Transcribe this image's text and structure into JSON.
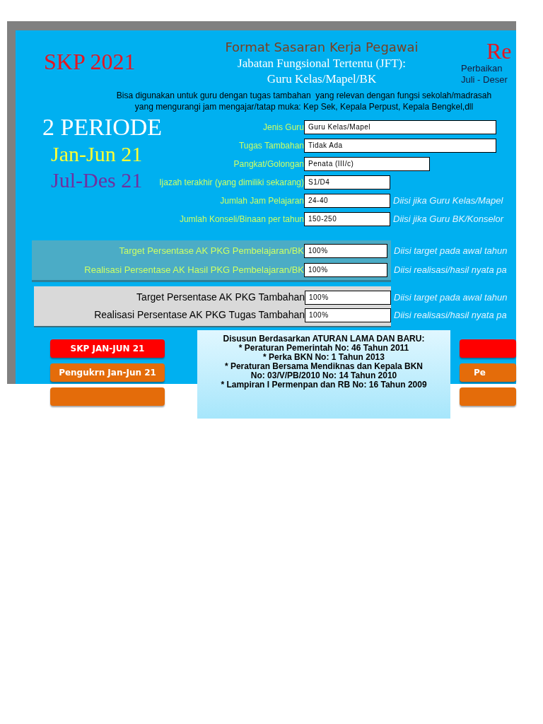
{
  "header": {
    "badge": "SKP 2021",
    "title": "Format Sasaran Kerja Pegawai",
    "subtitle_lines": [
      "Jabatan Fungsional Tertentu (JFT):",
      "Guru Kelas/Mapel/BK"
    ],
    "revision_title": "Re",
    "revision_lines": [
      "Perbaikan",
      "Juli - Deser"
    ]
  },
  "description_lines": [
    "Bisa digunakan untuk guru dengan tugas tambahan  yang relevan dengan fungsi sekolah/madrasah",
    "yang mengurangi jam mengajar/tatap muka: Kep Sek, Kepala Perpust, Kepala Bengkel,dll"
  ],
  "periods": {
    "heading": "2 PERIODE",
    "items": [
      {
        "label": "Jan-Jun 21",
        "color": "#ffff33"
      },
      {
        "label": "Jul-Des 21",
        "color": "#7030a0"
      }
    ]
  },
  "fields": [
    {
      "label": "Jenis Guru",
      "value": "Guru Kelas/Mapel"
    },
    {
      "label": "Tugas Tambahan",
      "value": "Tidak Ada"
    },
    {
      "label": "Pangkat/Golongan",
      "value": "Penata (III/c)"
    },
    {
      "label": "Ijazah terakhir (yang dimiliki sekarang)",
      "value": "S1/D4"
    },
    {
      "label": "Jumlah Jam Pelajaran",
      "value": "24-40",
      "note": "Diisi jika Guru Kelas/Mapel"
    },
    {
      "label": "Jumlah Konseli/Binaan per tahun",
      "value": "150-250",
      "note": "Diisi jika Guru BK/Konselor"
    }
  ],
  "pkg_pembelajaran": [
    {
      "label": "Target Persentase AK  PKG Pembelajaran/BK",
      "value": "100%",
      "note": "Diisi target pada awal tahun"
    },
    {
      "label": "Realisasi Persentase AK  Hasil PKG Pembelajaran/BK",
      "value": "100%",
      "note": "Diisi realisasi/hasil nyata pa"
    }
  ],
  "pkg_tambahan": [
    {
      "label": "Target Persentase AK PKG Tambahan",
      "value": "100%",
      "note": "Diisi target pada awal tahun"
    },
    {
      "label": "Realisasi Persentase AK PKG Tugas Tambahan",
      "value": "100%",
      "note": "Diisi realisasi/hasil nyata pa"
    }
  ],
  "left_buttons": [
    {
      "label": "SKP JAN-JUN 21",
      "color": "#ff0000"
    },
    {
      "label": "Pengukrn Jan-Jun 21",
      "color": "#e46c0a"
    },
    {
      "color": "#e46c0a"
    }
  ],
  "info": {
    "lines": [
      "Disusun Berdasarkan ATURAN LAMA DAN BARU:",
      "* Peraturan Pemerintah No: 46 Tahun 2011",
      "* Perka BKN No: 1 Tahun 2013",
      "* Peraturan Bersama Mendiknas dan Kepala BKN",
      "No: 03/V/PB/2010 No: 14 Tahun 2010",
      "* Lampiran I Permenpan dan RB No: 16 Tahun 2009"
    ]
  },
  "right_buttons": [
    {
      "color": "#ff0000"
    },
    {
      "label": "Pe",
      "color": "#e46c0a"
    },
    {
      "color": "#e46c0a"
    }
  ]
}
